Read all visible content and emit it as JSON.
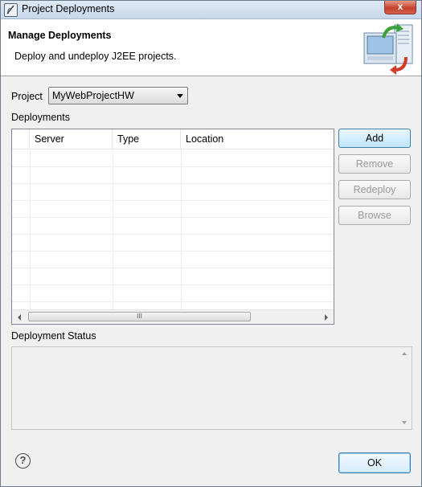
{
  "window": {
    "title": "Project Deployments",
    "close_glyph": "x"
  },
  "banner": {
    "title": "Manage Deployments",
    "description": "Deploy and undeploy J2EE projects.",
    "icon": "deploy-server-icon"
  },
  "form": {
    "project_label": "Project",
    "project_value": "MyWebProjectHW",
    "deployments_label": "Deployments"
  },
  "table": {
    "columns": [
      "Server",
      "Type",
      "Location"
    ],
    "rows": [],
    "scroll_grip": "III"
  },
  "buttons": {
    "add": "Add",
    "remove": "Remove",
    "redeploy": "Redeploy",
    "browse": "Browse"
  },
  "status": {
    "label": "Deployment Status",
    "text": ""
  },
  "footer": {
    "help_glyph": "?",
    "ok": "OK"
  },
  "colors": {
    "primary_button_border": "#3c7fb1",
    "disabled_text": "#9a9a9a",
    "close_button": "#c5432d"
  }
}
